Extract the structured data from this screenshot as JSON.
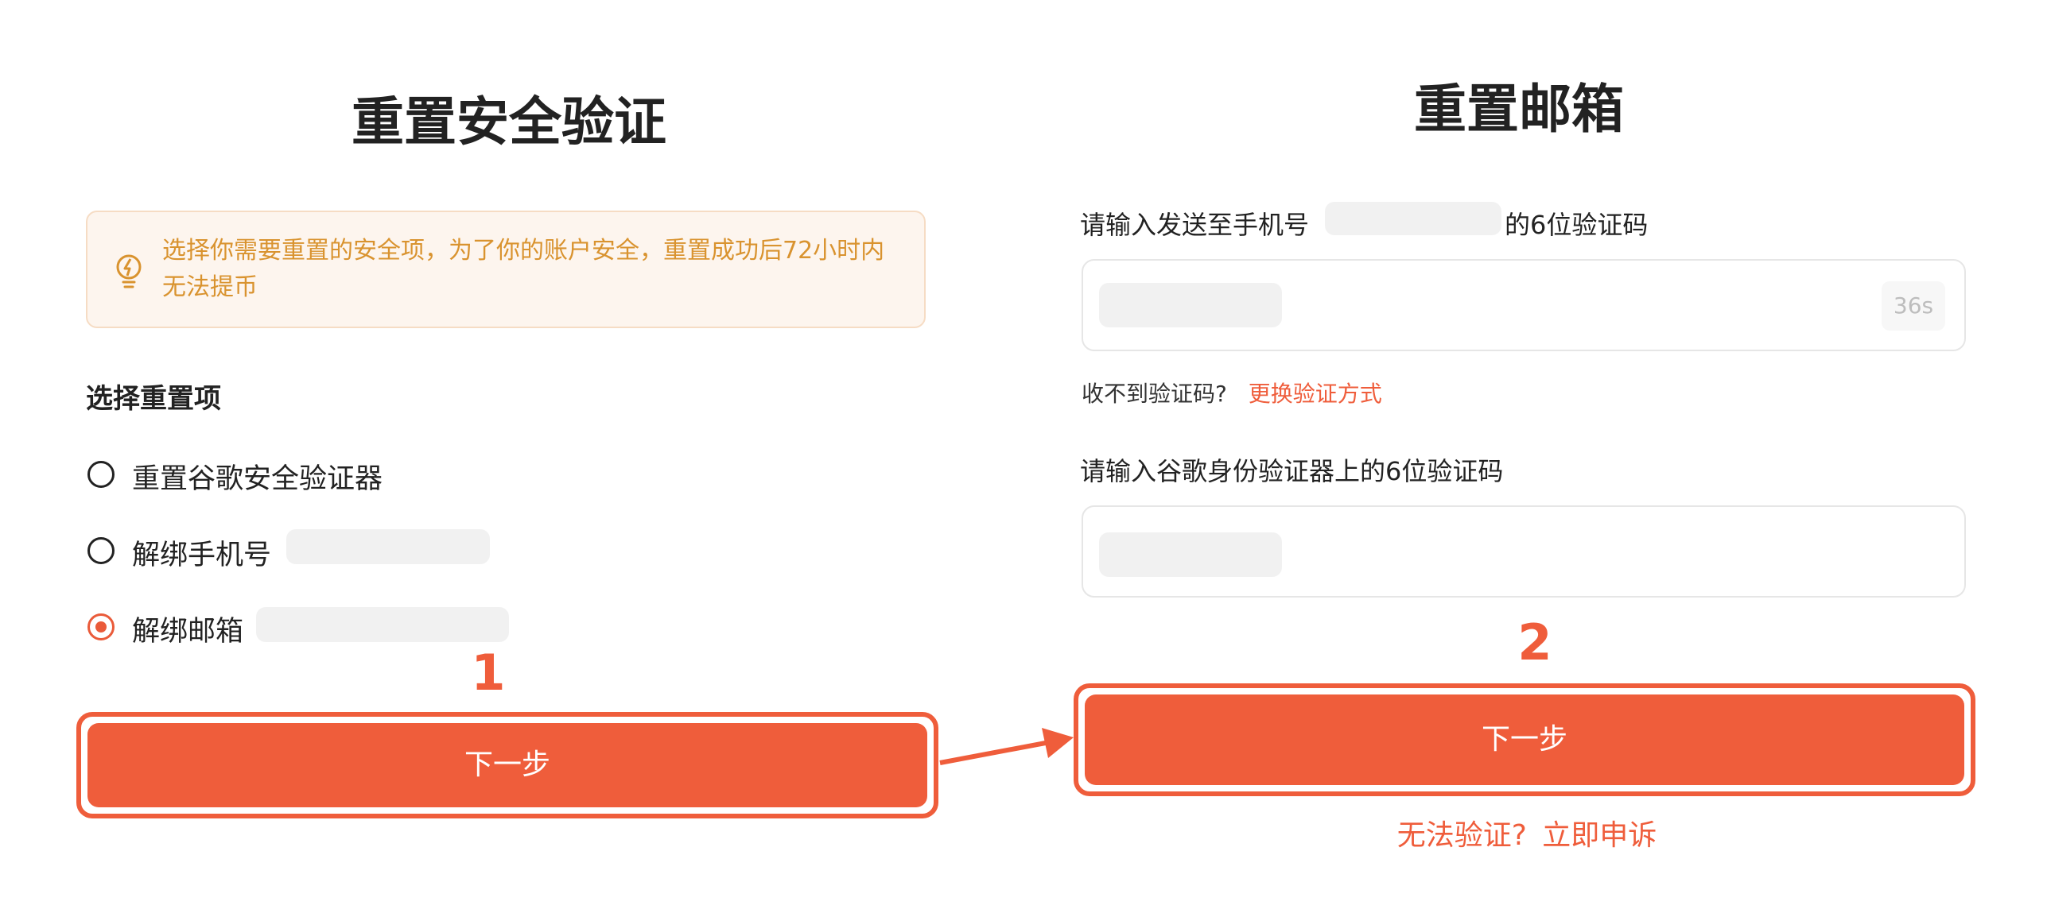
{
  "left": {
    "title": "重置安全验证",
    "notice": "选择你需要重置的安全项，为了你的账户安全，重置成功后72小时内无法提币",
    "section_label": "选择重置项",
    "options": [
      {
        "label": "重置谷歌安全验证器",
        "checked": false
      },
      {
        "label": "解绑手机号",
        "checked": false
      },
      {
        "label": "解绑邮箱",
        "checked": true
      }
    ],
    "step_number": "1",
    "next_label": "下一步"
  },
  "right": {
    "title": "重置邮箱",
    "sms_label_prefix": "请输入发送至手机号",
    "sms_label_suffix": "的6位验证码",
    "countdown": "36s",
    "no_code_text": "收不到验证码?",
    "switch_method": "更换验证方式",
    "google_label": "请输入谷歌身份验证器上的6位验证码",
    "step_number": "2",
    "next_label": "下一步",
    "cannot_verify": "无法验证?",
    "appeal": "立即申诉"
  },
  "colors": {
    "accent": "#ef5d3b",
    "notice_text": "#d9932f",
    "notice_bg": "#fdf5ee"
  }
}
